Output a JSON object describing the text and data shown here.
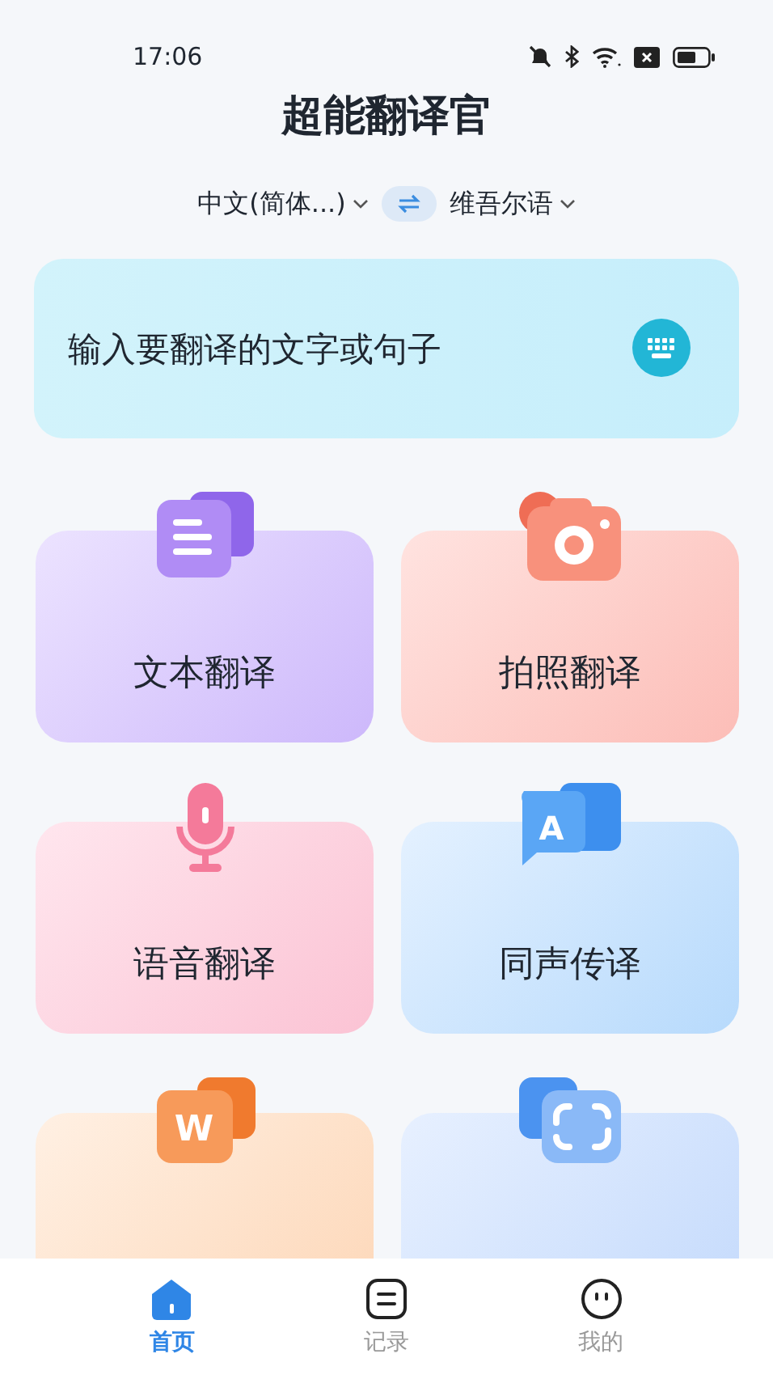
{
  "status_bar": {
    "time": "17:06"
  },
  "title": "超能翻译官",
  "languages": {
    "source": "中文(简体...)",
    "target": "维吾尔语"
  },
  "input": {
    "placeholder": "输入要翻译的文字或句子"
  },
  "feature_rows": [
    [
      {
        "kind": "text",
        "label": "文本翻译"
      },
      {
        "kind": "photo",
        "label": "拍照翻译"
      }
    ],
    [
      {
        "kind": "voice",
        "label": "语音翻译"
      },
      {
        "kind": "simultaneous",
        "label": "同声传译",
        "glyph": "A"
      }
    ],
    [
      {
        "kind": "document",
        "glyph": "W"
      },
      {
        "kind": "screen"
      }
    ]
  ],
  "tab_bar": [
    {
      "kind": "home",
      "label": "首页",
      "selected": true
    },
    {
      "kind": "records",
      "label": "记录",
      "selected": false
    },
    {
      "kind": "profile",
      "label": "我的",
      "selected": false
    }
  ]
}
